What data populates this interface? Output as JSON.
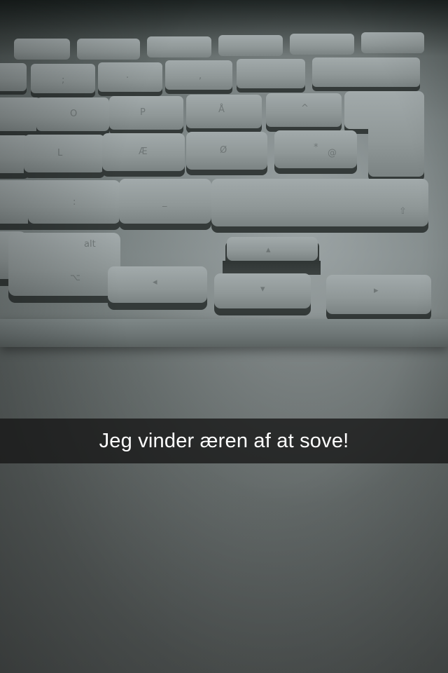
{
  "photo": {
    "subject": "keyboard-keys"
  },
  "caption": {
    "text": "Jeg vinder æren af at sove!"
  },
  "colors": {
    "caption_bg": "#161616",
    "caption_fg": "#ffffff",
    "key_face": "#8e9696"
  }
}
